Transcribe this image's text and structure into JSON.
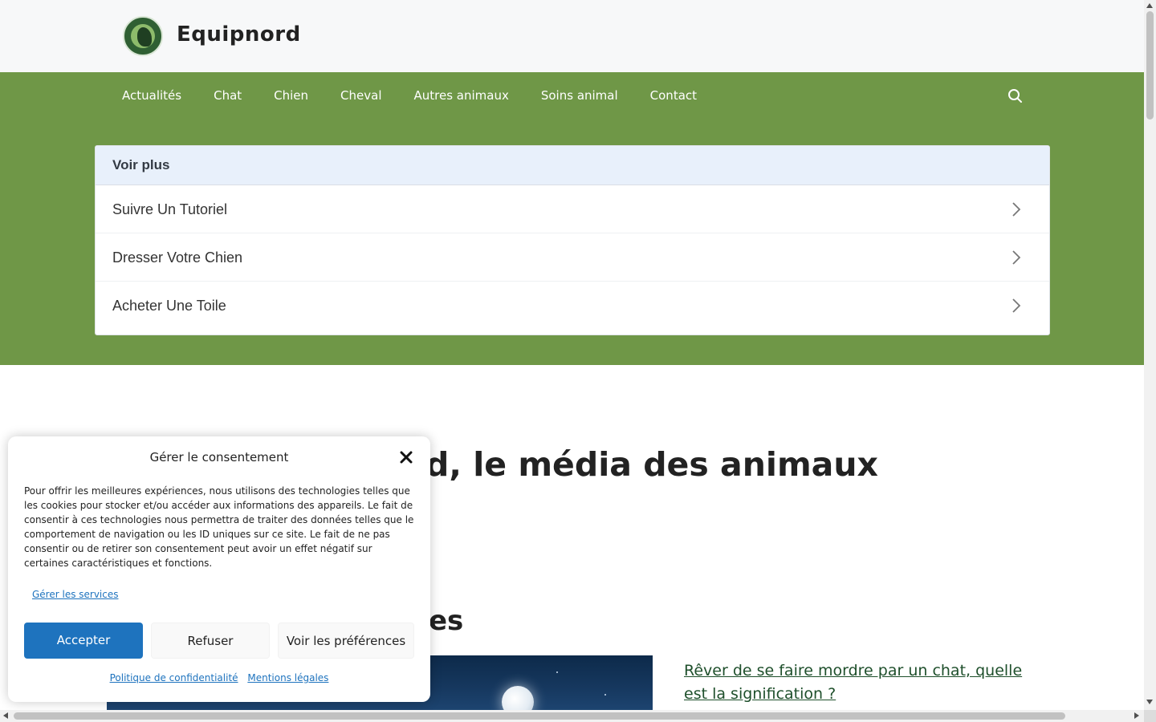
{
  "header": {
    "site_title": "Equipnord",
    "logo_icon": "equipnord-logo"
  },
  "nav": {
    "items": [
      {
        "label": "Actualités"
      },
      {
        "label": "Chat"
      },
      {
        "label": "Chien"
      },
      {
        "label": "Cheval"
      },
      {
        "label": "Autres animaux"
      },
      {
        "label": "Soins animal"
      },
      {
        "label": "Contact"
      }
    ],
    "search_icon": "search-icon"
  },
  "voir_plus": {
    "title": "Voir plus",
    "items": [
      {
        "label": "Suivre Un Tutoriel"
      },
      {
        "label": "Dresser Votre Chien"
      },
      {
        "label": "Acheter Une Toile"
      }
    ],
    "item_icon": "chevron-right-icon"
  },
  "main": {
    "heading_visible": "d, le média des animaux",
    "subheading_visible": "es",
    "article_link": "Rêver de se faire mordre par un chat, quelle est la signification ?"
  },
  "consent": {
    "title": "Gérer le consentement",
    "close_icon": "close-icon",
    "text": "Pour offrir les meilleures expériences, nous utilisons des technologies telles que les cookies pour stocker et/ou accéder aux informations des appareils. Le fait de consentir à ces technologies nous permettra de traiter des données telles que le comportement de navigation ou les ID uniques sur ce site. Le fait de ne pas consentir ou de retirer son consentement peut avoir un effet négatif sur certaines caractéristiques et fonctions.",
    "manage_services": "Gérer les services",
    "accept": "Accepter",
    "refuse": "Refuser",
    "preferences": "Voir les préférences",
    "privacy_policy": "Politique de confidentialité",
    "legal": "Mentions légales"
  },
  "colors": {
    "brand_green": "#6f9747",
    "link_green": "#1e4f2b",
    "consent_blue": "#1e73be",
    "voir_header_bg": "#e8f0fb"
  }
}
